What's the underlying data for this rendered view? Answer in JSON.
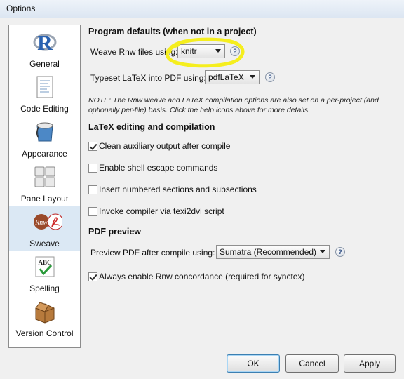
{
  "window": {
    "title": "Options"
  },
  "sidebar": {
    "items": [
      {
        "label": "General",
        "icon": "r-logo-icon"
      },
      {
        "label": "Code Editing",
        "icon": "document-icon"
      },
      {
        "label": "Appearance",
        "icon": "paint-bucket-icon"
      },
      {
        "label": "Pane Layout",
        "icon": "pane-layout-icon"
      },
      {
        "label": "Sweave",
        "icon": "sweave-icon",
        "active": true
      },
      {
        "label": "Spelling",
        "icon": "spelling-icon"
      },
      {
        "label": "Version Control",
        "icon": "box-icon"
      }
    ]
  },
  "program_defaults": {
    "heading": "Program defaults (when not in a project)",
    "weave_label": "Weave Rnw files using:",
    "weave_value": "knitr",
    "typeset_label": "Typeset LaTeX into PDF using:",
    "typeset_value": "pdfLaTeX",
    "note": "NOTE: The Rnw weave and LaTeX compilation options are also set on a per-project (and optionally per-file) basis. Click the help icons above for more details."
  },
  "latex": {
    "heading": "LaTeX editing and compilation",
    "options": [
      {
        "label": "Clean auxiliary output after compile",
        "checked": true
      },
      {
        "label": "Enable shell escape commands",
        "checked": false
      },
      {
        "label": "Insert numbered sections and subsections",
        "checked": false
      },
      {
        "label": "Invoke compiler via texi2dvi script",
        "checked": false
      }
    ]
  },
  "pdf_preview": {
    "heading": "PDF preview",
    "preview_label": "Preview PDF after compile using:",
    "preview_value": "Sumatra (Recommended)",
    "concordance_label": "Always enable Rnw concordance (required for synctex)",
    "concordance_checked": true
  },
  "buttons": {
    "ok": "OK",
    "cancel": "Cancel",
    "apply": "Apply"
  },
  "help_symbol": "?",
  "annotation_color": "#f5ee1e"
}
